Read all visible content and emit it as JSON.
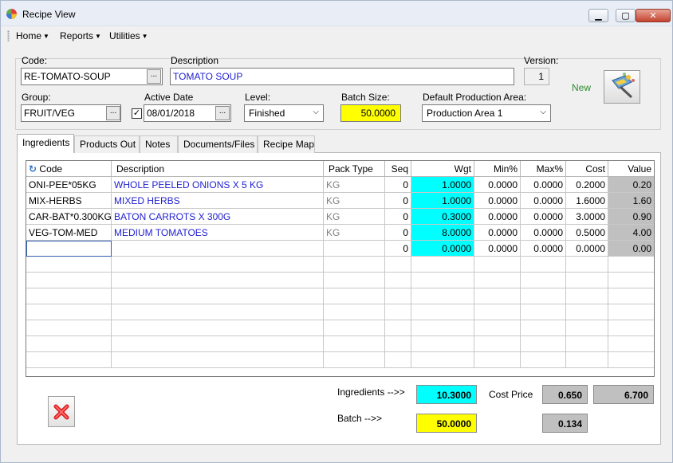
{
  "window": {
    "title": "Recipe View",
    "minimize": "▁",
    "maximize": "▢",
    "close": "✕"
  },
  "menu": [
    {
      "label": "Home"
    },
    {
      "label": "Reports"
    },
    {
      "label": "Utilities"
    }
  ],
  "header": {
    "code_label": "Code:",
    "code_value": "RE-TOMATO-SOUP",
    "description_label": "Description",
    "description_value": "TOMATO SOUP",
    "version_label": "Version:",
    "version_value": "1",
    "status": "New",
    "group_label": "Group:",
    "group_value": "FRUIT/VEG",
    "active_date_label": "Active Date",
    "active_date_value": "08/01/2018",
    "active_checked": true,
    "level_label": "Level:",
    "level_value": "Finished",
    "batch_size_label": "Batch Size:",
    "batch_size_value": "50.0000",
    "production_area_label": "Default Production Area:",
    "production_area_value": "Production Area 1",
    "browse_button": "..."
  },
  "tabs": [
    {
      "label": "Ingredients",
      "active": true
    },
    {
      "label": "Products Out"
    },
    {
      "label": "Notes"
    },
    {
      "label": "Documents/Files"
    },
    {
      "label": "Recipe Map"
    }
  ],
  "grid": {
    "columns": [
      "Code",
      "Description",
      "Pack Type",
      "Seq",
      "Wgt",
      "Min%",
      "Max%",
      "Cost",
      "Value"
    ],
    "rows": [
      {
        "code": "ONI-PEE*05KG",
        "description": "WHOLE PEELED ONIONS X 5 KG",
        "pack": "KG",
        "seq": "0",
        "wgt": "1.0000",
        "min": "0.0000",
        "max": "0.0000",
        "cost": "0.2000",
        "value": "0.20"
      },
      {
        "code": "MIX-HERBS",
        "description": "MIXED HERBS",
        "pack": "KG",
        "seq": "0",
        "wgt": "1.0000",
        "min": "0.0000",
        "max": "0.0000",
        "cost": "1.6000",
        "value": "1.60"
      },
      {
        "code": "CAR-BAT*0.300KG",
        "description": "BATON CARROTS X 300G",
        "pack": "KG",
        "seq": "0",
        "wgt": "0.3000",
        "min": "0.0000",
        "max": "0.0000",
        "cost": "3.0000",
        "value": "0.90"
      },
      {
        "code": "VEG-TOM-MED",
        "description": "MEDIUM TOMATOES",
        "pack": "KG",
        "seq": "0",
        "wgt": "8.0000",
        "min": "0.0000",
        "max": "0.0000",
        "cost": "0.5000",
        "value": "4.00"
      },
      {
        "code": "",
        "description": "",
        "pack": "",
        "seq": "0",
        "wgt": "0.0000",
        "min": "0.0000",
        "max": "0.0000",
        "cost": "0.0000",
        "value": "0.00"
      }
    ]
  },
  "totals": {
    "ingredients_label": "Ingredients -->>",
    "ingredients_value": "10.3000",
    "batch_label": "Batch  -->>",
    "batch_value": "50.0000",
    "cost_price_label": "Cost Price",
    "cost_price_value": "0.650",
    "total_value": "6.700",
    "unit_cost_value": "0.134"
  },
  "colors": {
    "cyan": "#00ffff",
    "yellow": "#ffff00",
    "grey": "#c0c0c0",
    "link_blue": "#1f1fd0",
    "status_green": "#2e8b2e"
  }
}
